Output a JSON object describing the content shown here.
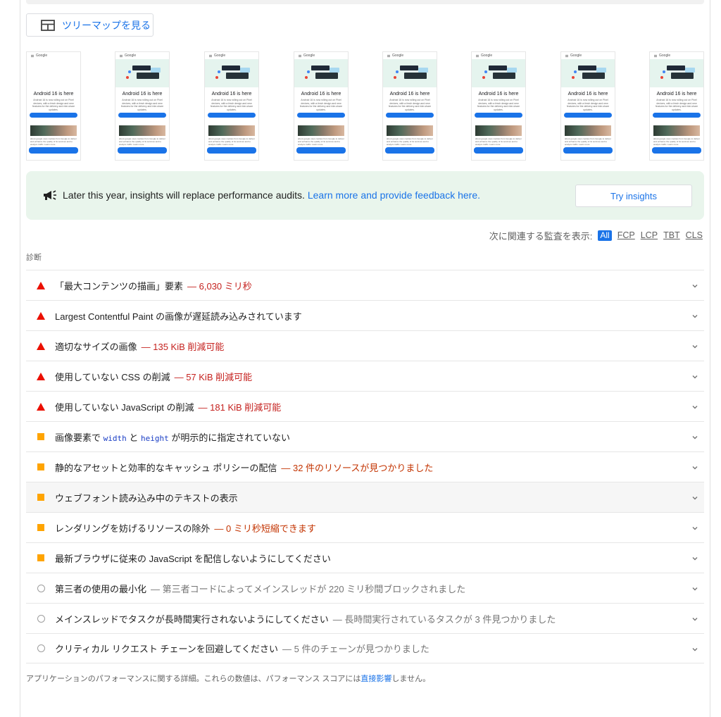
{
  "treemap": {
    "label": "ツリーマップを見る"
  },
  "filmstrip": {
    "frames": [
      {
        "title": "Android 16 is here",
        "logo": "Google"
      },
      {
        "title": "Android 16 is here",
        "logo": "Google"
      },
      {
        "title": "Android 16 is here",
        "logo": "Google"
      },
      {
        "title": "Android 16 is here",
        "logo": "Google"
      },
      {
        "title": "Android 16 is here",
        "logo": "Google"
      },
      {
        "title": "Android 16 is here",
        "logo": "Google"
      },
      {
        "title": "Android 16 is here",
        "logo": "Google"
      },
      {
        "title": "Android 16 is here",
        "logo": "Google"
      }
    ],
    "body_text": "Android 16 is now rolling out on Pixel devices, with a fresh design and new features for the delivery and ride-share updates.",
    "cta_label": "Check it out",
    "cookie_text": "about.google uses cookies from Google to deliver and enhance the quality of its services and to analyze traffic. Learn more",
    "ok_label": "OK, got it"
  },
  "insights": {
    "message": "Later this year, insights will replace performance audits.",
    "link": "Learn more and provide feedback here.",
    "button": "Try insights"
  },
  "filter": {
    "label": "次に関連する監査を表示:",
    "options": [
      "All",
      "FCP",
      "LCP",
      "TBT",
      "CLS"
    ],
    "selected": "All"
  },
  "diagnostics": {
    "title": "診断",
    "audits": [
      {
        "status": "fail",
        "title": "「最大コンテンツの描画」要素",
        "display": "— 6,030 ミリ秒"
      },
      {
        "status": "fail",
        "title": "Largest Contentful Paint の画像が遅延読み込みされています",
        "display": ""
      },
      {
        "status": "fail",
        "title": "適切なサイズの画像",
        "display": "— 135 KiB 削減可能"
      },
      {
        "status": "fail",
        "title": "使用していない CSS の削減",
        "display": "— 57 KiB 削減可能"
      },
      {
        "status": "fail",
        "title": "使用していない JavaScript の削減",
        "display": "— 181 KiB 削減可能"
      },
      {
        "status": "average",
        "title_pre": "画像要素で",
        "code1": "width",
        "title_mid": "と",
        "code2": "height",
        "title_post": "が明示的に指定されていない"
      },
      {
        "status": "average",
        "title": "静的なアセットと効率的なキャッシュ ポリシーの配信",
        "display": "— 32 件のリソースが見つかりました"
      },
      {
        "status": "average",
        "title": "ウェブフォント読み込み中のテキストの表示",
        "display": ""
      },
      {
        "status": "average",
        "title": "レンダリングを妨げるリソースの除外",
        "display": "— 0 ミリ秒短縮できます"
      },
      {
        "status": "average",
        "title": "最新ブラウザに従来の JavaScript を配信しないようにしてください",
        "display": ""
      },
      {
        "status": "info",
        "title": "第三者の使用の最小化",
        "display": "— 第三者コードによってメインスレッドが 220 ミリ秒間ブロックされました"
      },
      {
        "status": "info",
        "title": "メインスレッドでタスクが長時間実行されないようにしてください",
        "display": "— 長時間実行されているタスクが 3 件見つかりました"
      },
      {
        "status": "info",
        "title": "クリティカル リクエスト チェーンを回避してください",
        "display": "— 5 件のチェーンが見つかりました"
      }
    ]
  },
  "footnote": {
    "pre": "アプリケーションのパフォーマンスに関する詳細。これらの数値は、パフォーマンス スコアには",
    "link": "直接影響",
    "post": "しません。"
  },
  "colors": {
    "fail": "#eb0f00",
    "average": "#ffa400",
    "info": "#9e9e9e",
    "link": "#1a73e8"
  }
}
